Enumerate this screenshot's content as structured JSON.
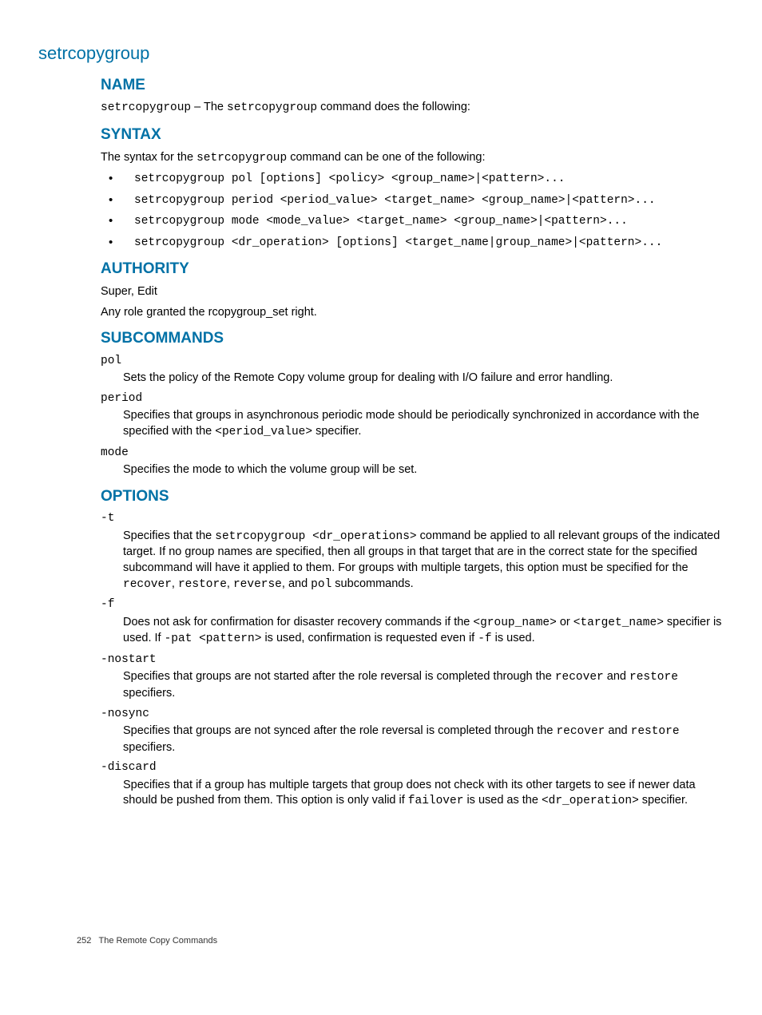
{
  "pageTitle": "setrcopygroup",
  "name": {
    "heading": "NAME",
    "cmd": "setrcopygroup",
    "sep": " – The ",
    "cmd2": "setrcopygroup",
    "tail": " command does the following:"
  },
  "syntax": {
    "heading": "SYNTAX",
    "intro_pre": "The syntax for the ",
    "intro_cmd": "setrcopygroup",
    "intro_post": " command can be one of the following:",
    "items": [
      "setrcopygroup pol [options] <policy> <group_name>|<pattern>...",
      "setrcopygroup period <period_value> <target_name> <group_name>|<pattern>...",
      "setrcopygroup mode <mode_value> <target_name> <group_name>|<pattern>...",
      "setrcopygroup <dr_operation> [options] <target_name|group_name>|<pattern>..."
    ]
  },
  "authority": {
    "heading": "AUTHORITY",
    "line1": "Super, Edit",
    "line2": "Any role granted the rcopygroup_set right."
  },
  "subcommands": {
    "heading": "SUBCOMMANDS",
    "items": [
      {
        "term": "pol",
        "desc": "Sets the policy of the Remote Copy volume group for dealing with I/O failure and error handling."
      },
      {
        "term": "period",
        "desc_pre": "Specifies that groups in asynchronous periodic mode should be periodically synchronized in accordance with the specified with the ",
        "desc_code": "<period_value>",
        "desc_post": " specifier."
      },
      {
        "term": "mode",
        "desc": "Specifies the mode to which the volume group will be set."
      }
    ]
  },
  "options": {
    "heading": "OPTIONS",
    "items": [
      {
        "term": "-t",
        "p1a": "Specifies that the ",
        "p1b": "setrcopygroup <dr_operations>",
        "p1c": " command be applied to all relevant groups of the indicated target. If no group names are specified, then all groups in that target that are in the correct state for the specified subcommand will have it applied to them. For groups with multiple targets, this option must be specified for the ",
        "p1d": "recover",
        "p1e": ", ",
        "p1f": "restore",
        "p1g": ", ",
        "p1h": "reverse",
        "p1i": ", and ",
        "p1j": "pol",
        "p1k": " subcommands."
      },
      {
        "term": "-f",
        "p1a": "Does not ask for confirmation for disaster recovery commands if the ",
        "p1b": "<group_name>",
        "p1c": " or ",
        "p1d": "<target_name>",
        "p1e": " specifier is used. If ",
        "p1f": "-pat <pattern>",
        "p1g": " is used, confirmation is requested even if ",
        "p1h": "-f",
        "p1i": " is used."
      },
      {
        "term": "-nostart",
        "p1a": "Specifies that groups are not started after the role reversal is completed through the ",
        "p1b": "recover",
        "p1c": " and ",
        "p1d": "restore",
        "p1e": " specifiers."
      },
      {
        "term": "-nosync",
        "p1a": "Specifies that groups are not synced after the role reversal is completed through the ",
        "p1b": "recover",
        "p1c": " and ",
        "p1d": "restore",
        "p1e": " specifiers."
      },
      {
        "term": "-discard",
        "p1a": "Specifies that if a group has multiple targets that group does not check with its other targets to see if newer data should be pushed from them. This option is only valid if ",
        "p1b": "failover",
        "p1c": " is used as the ",
        "p1d": "<dr_operation>",
        "p1e": " specifier."
      }
    ]
  },
  "footer": {
    "pagenum": "252",
    "label": "The Remote Copy Commands"
  }
}
